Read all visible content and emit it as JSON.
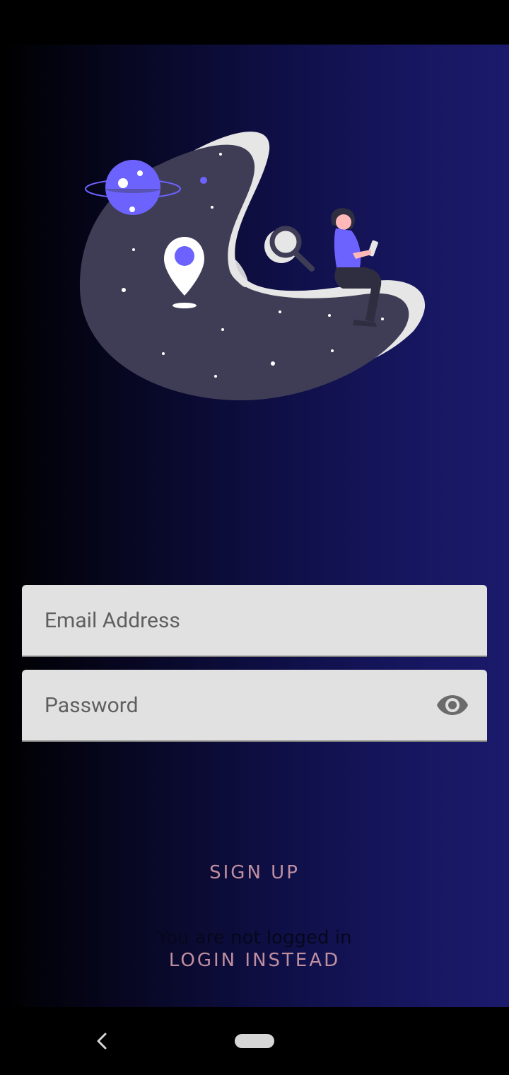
{
  "form": {
    "email_placeholder": "Email Address",
    "password_placeholder": "Password"
  },
  "icons": {
    "password_visibility": "eye-icon",
    "nav_back": "chevron-left-icon",
    "nav_home": "home-pill-icon"
  },
  "actions": {
    "signup_label": "SIGN UP",
    "login_label": "LOGIN INSTEAD"
  },
  "status": {
    "login_state": "You are not logged in"
  },
  "colors": {
    "accent_text": "#bf8fa0",
    "gradient_dark": "#000000",
    "gradient_light": "#1b1a6c",
    "field_bg": "#e1e1e1",
    "illustration_purple": "#6c63ff"
  }
}
